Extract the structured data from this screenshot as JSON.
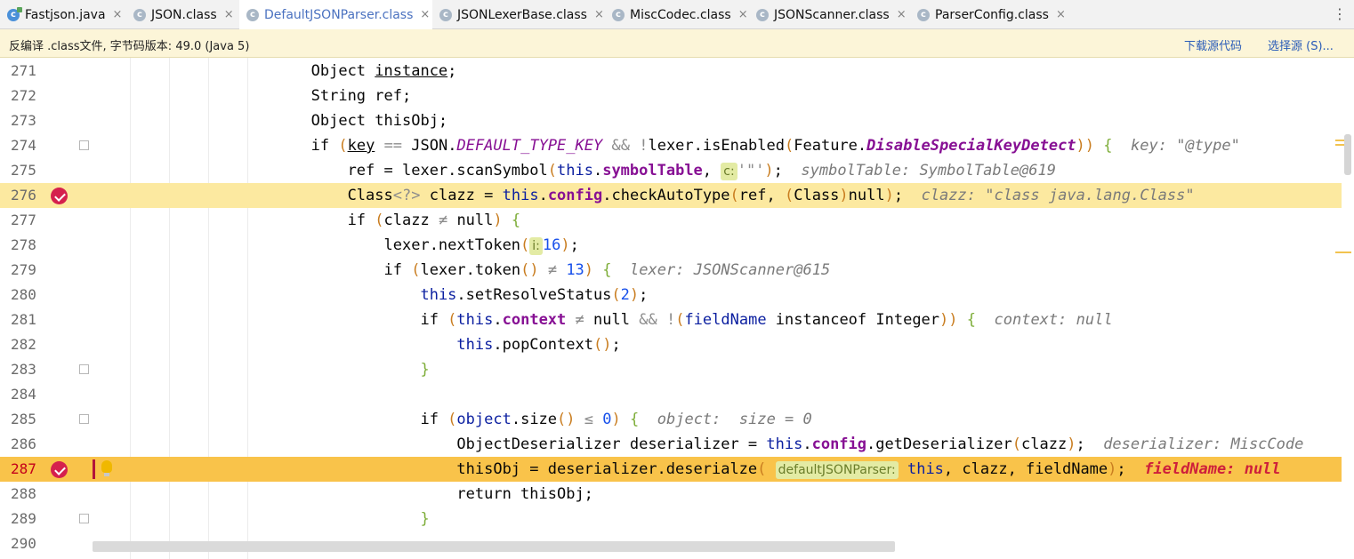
{
  "tabs": [
    {
      "label": "Fastjson.java",
      "icon": "java-class-file-icon",
      "active": false
    },
    {
      "label": "JSON.class",
      "icon": "class-file-icon",
      "active": false
    },
    {
      "label": "DefaultJSONParser.class",
      "icon": "class-file-icon",
      "active": true
    },
    {
      "label": "JSONLexerBase.class",
      "icon": "class-file-icon",
      "active": false
    },
    {
      "label": "MiscCodec.class",
      "icon": "class-file-icon",
      "active": false
    },
    {
      "label": "JSONScanner.class",
      "icon": "class-file-icon",
      "active": false
    },
    {
      "label": "ParserConfig.class",
      "icon": "class-file-icon",
      "active": false
    }
  ],
  "tab_close_glyph": "×",
  "tab_icon_letter": "c",
  "menu_glyph": "⋮",
  "infobar": {
    "message": "反编译 .class文件, 字节码版本: 49.0 (Java 5)",
    "download_source": "下载源代码",
    "choose_source": "选择源 (S)..."
  },
  "editor": {
    "line_numbers": [
      "271",
      "272",
      "273",
      "274",
      "275",
      "276",
      "277",
      "278",
      "279",
      "280",
      "281",
      "282",
      "283",
      "284",
      "285",
      "286",
      "287",
      "288",
      "289",
      "290"
    ],
    "breakpoint_lines": [
      "276",
      "287"
    ],
    "current_line": "287",
    "hints": {
      "l274": "key: \"@type\"",
      "l275": "symbolTable: SymbolTable@619",
      "l276": "clazz: \"class java.lang.Class\"",
      "l279": "lexer: JSONScanner@615",
      "l281": "context: null",
      "l285": "object:  size = 0",
      "l286": "deserializer: MiscCode",
      "l287": "fieldName: null"
    },
    "param_hints": {
      "c": "c:",
      "i": "i:",
      "defaultJSONParser": "defaultJSONParser:"
    }
  },
  "colors": {
    "current_line": "#f9c34a",
    "breakpoint_line": "#fce9a0",
    "breakpoint": "#d5204d",
    "infobar": "#fcf5d8"
  }
}
